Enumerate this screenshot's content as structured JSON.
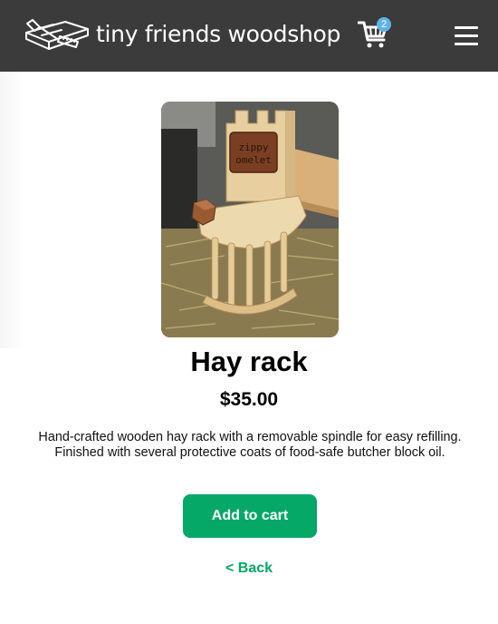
{
  "header": {
    "brand_name": "tiny friends woodshop",
    "cart_count": "2"
  },
  "product": {
    "title": "Hay rack",
    "price": "$35.00",
    "description": "Hand-crafted wooden hay rack with a removable spindle for easy refilling. Finished with several protective coats of food-safe butcher block oil.",
    "sign_text_line1": "zippy",
    "sign_text_line2": "omelet"
  },
  "actions": {
    "add_to_cart_label": "Add to cart",
    "back_label": "< Back"
  },
  "colors": {
    "header_bg": "#3b3b3b",
    "accent_green": "#05a866",
    "badge_blue": "#5fb3e8"
  }
}
